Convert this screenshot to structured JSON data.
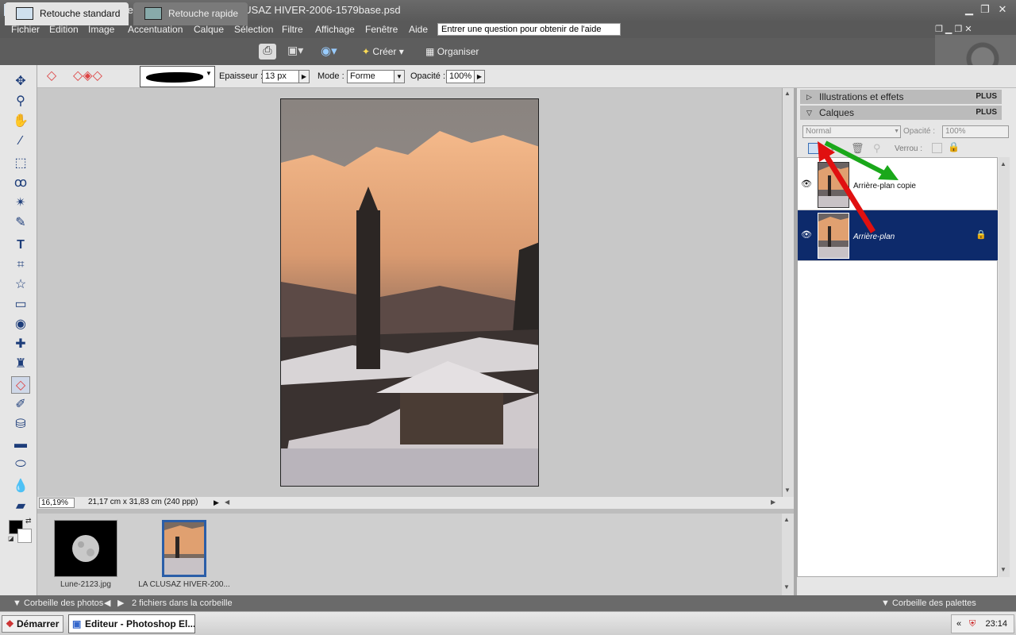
{
  "titlebar": {
    "title": "Adobe Photoshop Elements 5.0 (Editeur) - LA CLUSAZ HIVER-2006-1579base.psd"
  },
  "menu": [
    "Fichier",
    "Edition",
    "Image",
    "Accentuation",
    "Calque",
    "Sélection",
    "Filtre",
    "Affichage",
    "Fenêtre",
    "Aide"
  ],
  "help": {
    "placeholder": "Entrer une question pour obtenir de l'aide"
  },
  "modes": {
    "standard": "Retouche standard",
    "quick": "Retouche rapide",
    "create": "Créer",
    "organize": "Organiser"
  },
  "options": {
    "thickness_label": "Epaisseur :",
    "thickness_value": "13 px",
    "mode_label": "Mode :",
    "mode_value": "Forme",
    "opacity_label": "Opacité :",
    "opacity_value": "100%"
  },
  "status": {
    "zoom": "16,19%",
    "docsize": "21,17 cm x 31,83 cm (240 ppp)"
  },
  "bin": {
    "items": [
      {
        "name": "Lune-2123.jpg"
      },
      {
        "name": "LA CLUSAZ HIVER-200..."
      }
    ],
    "footer_label": "Corbeille des photos",
    "count_label": "2 fichiers dans la corbeille"
  },
  "palettes": {
    "illustrations": {
      "title": "Illustrations et effets",
      "plus": "PLUS"
    },
    "layers": {
      "title": "Calques",
      "plus": "PLUS",
      "blend_mode": "Normal",
      "opacity_label": "Opacité :",
      "opacity_value": "100%",
      "lock_label": "Verrou :",
      "items": [
        {
          "name": "Arrière-plan copie",
          "selected": false
        },
        {
          "name": "Arrière-plan",
          "selected": true
        }
      ]
    },
    "footer": "Corbeille des palettes"
  },
  "taskbar": {
    "start": "Démarrer",
    "task": "Editeur - Photoshop El...",
    "time": "23:14"
  },
  "colors": {
    "selection": "#0d2a6b",
    "annotation_red": "#e01010",
    "annotation_green": "#1aa81a"
  }
}
